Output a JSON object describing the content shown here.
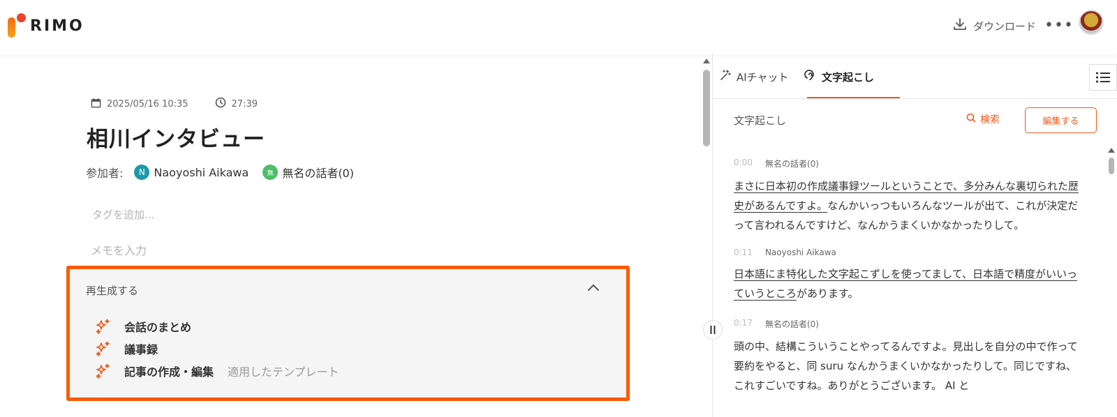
{
  "app": {
    "logo_text": "RIMO"
  },
  "header": {
    "download_label": "ダウンロード",
    "more_label": "•••"
  },
  "meeting": {
    "date": "2025/05/16 10:35",
    "duration": "27:39",
    "title": "相川インタビュー",
    "participants_label": "参加者:",
    "participants": [
      {
        "initial": "N",
        "name": "Naoyoshi Aikawa",
        "color": "#1a9aa8"
      },
      {
        "initial": "無",
        "name": "無名の話者(0)",
        "color": "#4cbf6a"
      }
    ],
    "tag_placeholder": "タグを追加...",
    "memo_placeholder": "メモを入力"
  },
  "regenerate": {
    "title": "再生成する",
    "items": [
      {
        "label": "会話のまとめ",
        "note": ""
      },
      {
        "label": "議事録",
        "note": ""
      },
      {
        "label": "記事の作成・編集",
        "note": "適用したテンプレート"
      }
    ]
  },
  "right_panel": {
    "tabs": [
      {
        "label": "AIチャット",
        "active": false
      },
      {
        "label": "文字起こし",
        "active": true
      }
    ],
    "section_title": "文字起こし",
    "search_label": "検索",
    "edit_label": "編集する",
    "transcript": [
      {
        "time": "0:00",
        "speaker": "無名の話者(0)",
        "underlined": "まさに日本初の作成議事録ツールということで、多分みんな裏切られた歴史があるんですよ。",
        "rest": "なんかいっつもいろんなツールが出て、これが決定だって言われるんですけど、なんかうまくいかなかったりして。"
      },
      {
        "time": "0:11",
        "speaker": "Naoyoshi Aikawa",
        "underlined": "日本語にま特化した文字起こずしを使ってまして、日本語で精度がいいっていうところ",
        "rest": "があります。"
      },
      {
        "time": "0:17",
        "speaker": "無名の話者(0)",
        "underlined": "",
        "rest": "頭の中、結構こういうことやってるんですよ。見出しを自分の中で作って要約をやると、同 suru なんかうまくいかなかったりして。同じですね、これすごいですね。ありがとうございます。 AI と"
      }
    ]
  },
  "colors": {
    "accent": "#ef5a1c",
    "highlight_border": "#ff5a00"
  }
}
